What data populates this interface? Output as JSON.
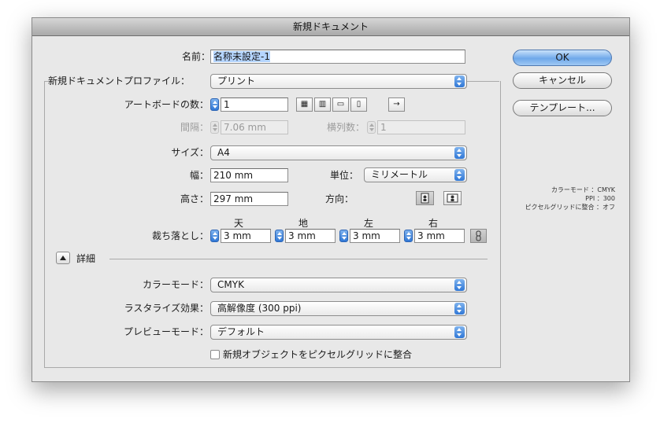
{
  "window": {
    "title": "新規ドキュメント"
  },
  "name": {
    "label": "名前：",
    "value": "名称未設定-1"
  },
  "profile": {
    "label": "新規ドキュメントプロファイル：",
    "value": "プリント"
  },
  "artboards": {
    "label": "アートボードの数：",
    "value": "1"
  },
  "spacing": {
    "label": "間隔：",
    "value": "7.06 mm"
  },
  "columns": {
    "label": "横列数：",
    "value": "1"
  },
  "size": {
    "label": "サイズ：",
    "value": "A4"
  },
  "width": {
    "label": "幅：",
    "value": "210 mm"
  },
  "units": {
    "label": "単位：",
    "value": "ミリメートル"
  },
  "height": {
    "label": "高さ：",
    "value": "297 mm"
  },
  "orientation": {
    "label": "方向："
  },
  "bleed": {
    "label": "裁ち落とし：",
    "headers": [
      "天",
      "地",
      "左",
      "右"
    ],
    "values": [
      "3 mm",
      "3 mm",
      "3 mm",
      "3 mm"
    ]
  },
  "advanced": {
    "label": "詳細"
  },
  "color_mode": {
    "label": "カラーモード：",
    "value": "CMYK"
  },
  "raster_effects": {
    "label": "ラスタライズ効果：",
    "value": "高解像度 (300 ppi)"
  },
  "preview_mode": {
    "label": "プレビューモード：",
    "value": "デフォルト"
  },
  "align_pixel_grid": {
    "label": "新規オブジェクトをピクセルグリッドに整合"
  },
  "buttons": {
    "ok": "OK",
    "cancel": "キャンセル",
    "templates": "テンプレート..."
  },
  "summary": {
    "color_mode": "カラーモード ：CMYK",
    "ppi": "PPI ：300",
    "pixel_grid": "ピクセルグリッドに整合 ：オフ"
  },
  "colors": {
    "accent": "#3b82dc",
    "dialog_bg": "#e8e8e8"
  }
}
